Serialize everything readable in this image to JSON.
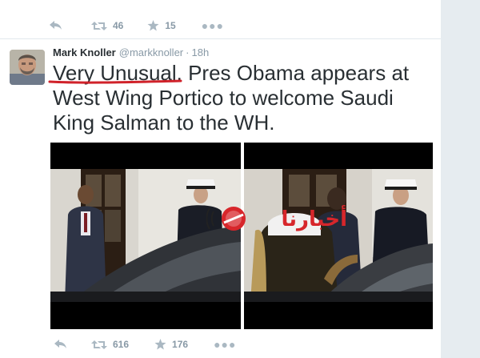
{
  "prev_tweet": {
    "retweet_count": "46",
    "favorite_count": "15"
  },
  "tweet": {
    "display_name": "Mark Knoller",
    "username": "@markknoller",
    "separator": "·",
    "timestamp": "18h",
    "text": "Very Unusual. Pres Obama appears at West Wing Portico to welcome Saudi King Salman to the WH.",
    "retweet_count": "616",
    "favorite_count": "176"
  },
  "watermark": {
    "arabic_text": "أخبارنا"
  },
  "colors": {
    "text": "#292f33",
    "secondary": "#8899a6",
    "divider": "#e1e8ed",
    "side_panel": "#e6ecf0",
    "annotation_red": "#d0222a"
  },
  "icons": {
    "reply": "reply-icon",
    "retweet": "retweet-icon",
    "favorite": "star-icon",
    "more": "more-icon"
  }
}
